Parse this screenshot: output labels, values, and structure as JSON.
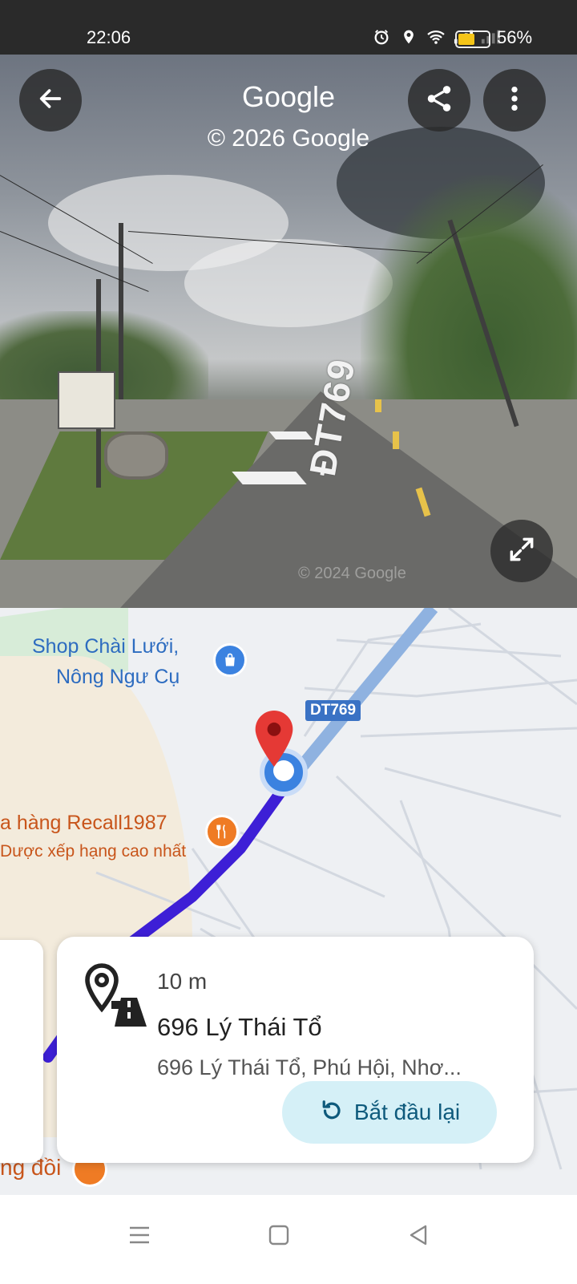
{
  "status_bar": {
    "time": "22:06",
    "battery_percent": "56%",
    "battery_level": 0.56,
    "icons": [
      "alarm-icon",
      "location-icon",
      "wifi-icon",
      "signal-icon",
      "signal-nodata-icon",
      "battery-icon"
    ]
  },
  "street_view": {
    "title": "Google",
    "copyright": "© 2026 Google",
    "road_marking": "ĐT769",
    "watermark": "© 2024 Google",
    "buttons": {
      "back": "back-arrow-icon",
      "share": "share-icon",
      "more": "more-vert-icon",
      "expand": "expand-icon"
    }
  },
  "map": {
    "route_badge": "DT769",
    "poi_shop": {
      "line1": "Shop Chài Lưới,",
      "line2": "Nông Ngư Cụ",
      "icon": "shopping-bag-icon"
    },
    "poi_restaurant": {
      "line1": "a hàng Recall1987",
      "line2": "Dược xếp hạng cao nhất",
      "icon": "restaurant-icon"
    },
    "poi_bottom": {
      "label": "ng đồi"
    },
    "colors": {
      "route": "#3d1fd6",
      "road": "#8fb2e0",
      "poi_blue": "#2d6cc0",
      "poi_orange": "#ef7b24"
    }
  },
  "place_card": {
    "distance": "10 m",
    "title": "696 Lý Thái Tổ",
    "address": "696 Lý Thái Tổ, Phú Hội, Nhơ...",
    "restart_label": "Bắt đầu lại",
    "icon": "place-road-icon"
  },
  "nav_bar": {
    "items": [
      "menu-icon",
      "home-icon",
      "back-icon"
    ]
  }
}
